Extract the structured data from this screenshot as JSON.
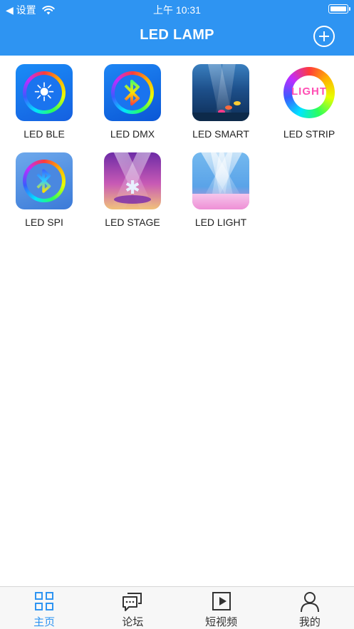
{
  "status_bar": {
    "back_label": "◀ 设置",
    "time": "上午 10:31",
    "wifi_icon": "wifi-icon",
    "battery_icon": "battery-icon"
  },
  "nav": {
    "title": "LED LAMP",
    "add_icon": "plus-circle-icon"
  },
  "apps": [
    {
      "label": "LED BLE",
      "icon": "led-ble-app-icon"
    },
    {
      "label": "LED DMX",
      "icon": "led-dmx-app-icon"
    },
    {
      "label": "LED SMART",
      "icon": "led-smart-app-icon"
    },
    {
      "label": "LED STRIP",
      "icon": "led-strip-app-icon",
      "icon_text": "LIGHT"
    },
    {
      "label": "LED SPI",
      "icon": "led-spi-app-icon"
    },
    {
      "label": "LED STAGE",
      "icon": "led-stage-app-icon"
    },
    {
      "label": "LED LIGHT",
      "icon": "led-light-app-icon"
    }
  ],
  "tabs": [
    {
      "label": "主页",
      "icon": "home-grid-icon",
      "active": true
    },
    {
      "label": "论坛",
      "icon": "forum-chat-icon",
      "active": false
    },
    {
      "label": "短视频",
      "icon": "video-play-icon",
      "active": false
    },
    {
      "label": "我的",
      "icon": "profile-user-icon",
      "active": false
    }
  ],
  "colors": {
    "accent": "#2e94f2",
    "header_text": "#ffffff",
    "label_text": "#222222",
    "tab_bar_bg": "#f7f7f7"
  }
}
